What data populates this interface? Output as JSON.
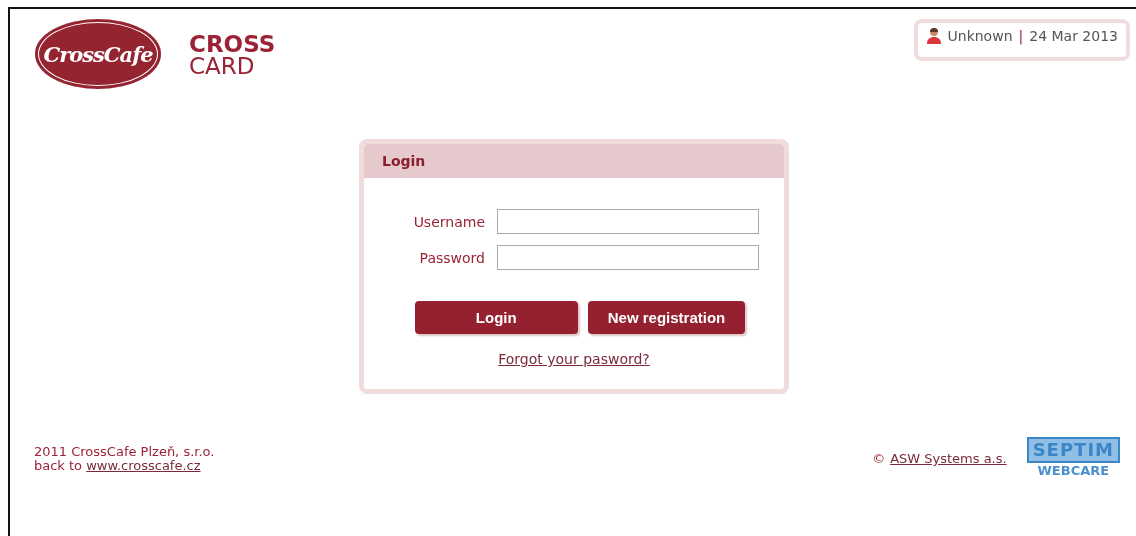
{
  "logo": {
    "script": "CrossCafe",
    "title_top": "CROSS",
    "title_bottom": "CARD"
  },
  "user_box": {
    "user": "Unknown",
    "separator": "|",
    "date": "24 Mar 2013"
  },
  "login_panel": {
    "title": "Login",
    "fields": [
      {
        "label": "Username"
      },
      {
        "label": "Password"
      }
    ],
    "buttons": [
      "Login",
      "New registration"
    ],
    "forgot_link": "Forgot your pasword?"
  },
  "footer": {
    "copyright": "2011 CrossCafe Plzeň, s.r.o.",
    "back_text": "back to",
    "back_link": "www.crosscafe.cz",
    "vendor_symbol": "©",
    "vendor_link": "ASW Systems a.s.",
    "vendor_logo_top": "SEPTIM",
    "vendor_logo_bottom": "WEBCARE"
  }
}
